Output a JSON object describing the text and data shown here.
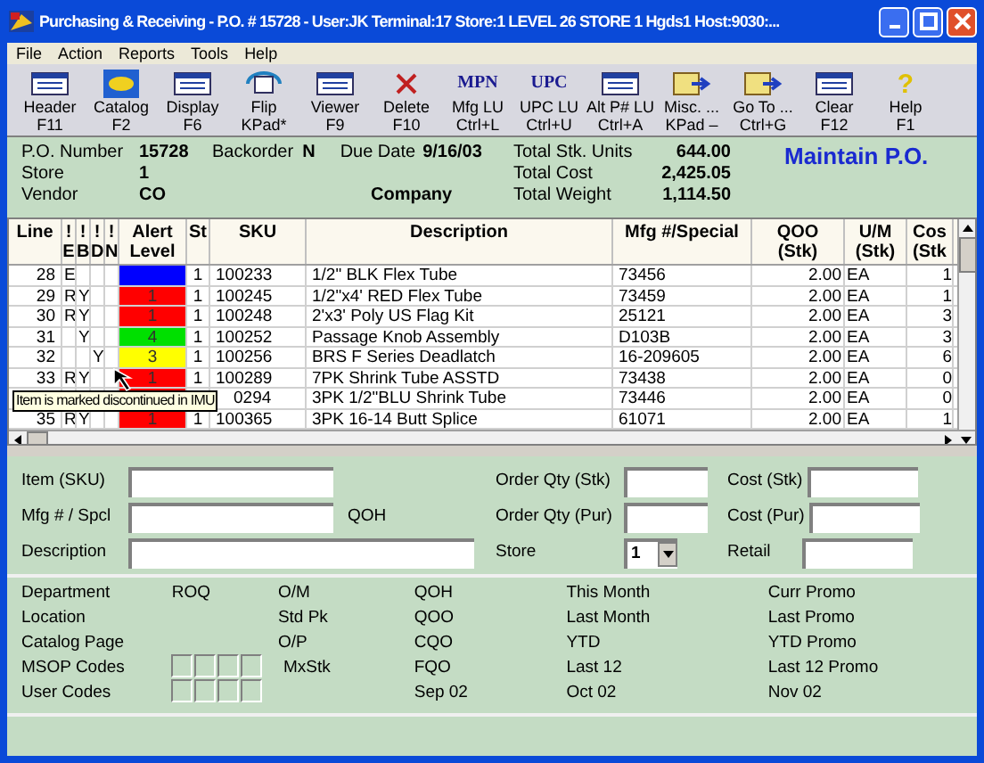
{
  "window": {
    "title": "Purchasing & Receiving - P.O. # 15728 - User:JK Terminal:17 Store:1 LEVEL 26 STORE 1 Hgds1 Host:9030:..."
  },
  "menu": [
    "File",
    "Action",
    "Reports",
    "Tools",
    "Help"
  ],
  "toolbar": [
    {
      "kind": "window",
      "label": "Header",
      "key": "F11"
    },
    {
      "kind": "catalog",
      "label": "Catalog",
      "key": "F2"
    },
    {
      "kind": "window",
      "label": "Display",
      "key": "F6"
    },
    {
      "kind": "flip",
      "label": "Flip",
      "key": "KPad*"
    },
    {
      "kind": "window",
      "label": "Viewer",
      "key": "F9"
    },
    {
      "kind": "x",
      "label": "Delete",
      "key": "F10"
    },
    {
      "kind": "text",
      "icon_text": "MPN",
      "label": "Mfg LU",
      "key": "Ctrl+L"
    },
    {
      "kind": "text",
      "icon_text": "UPC",
      "label": "UPC LU",
      "key": "Ctrl+U"
    },
    {
      "kind": "window",
      "label": "Alt P# LU",
      "key": "Ctrl+A"
    },
    {
      "kind": "folder",
      "label": "Misc. ...",
      "key": "KPad –"
    },
    {
      "kind": "folder",
      "label": "Go To ...",
      "key": "Ctrl+G"
    },
    {
      "kind": "window",
      "label": "Clear",
      "key": "F12"
    },
    {
      "kind": "question",
      "icon_text": "?",
      "label": "Help",
      "key": "F1"
    }
  ],
  "header": {
    "po_label": "P.O. Number",
    "po": "15728",
    "backorder_label": "Backorder",
    "backorder": "N",
    "due_label": "Due Date",
    "due": "9/16/03",
    "store_label": "Store",
    "store": "1",
    "vendor_label": "Vendor",
    "vendor": "CO",
    "vendor_name": "Company",
    "totals": [
      {
        "label": "Total Stk. Units",
        "value": "644.00"
      },
      {
        "label": "Total Cost",
        "value": "2,425.05"
      },
      {
        "label": "Total Weight",
        "value": "1,114.50"
      }
    ],
    "mode": "Maintain P.O."
  },
  "table": {
    "columns": [
      [
        "Line"
      ],
      [
        "!",
        "E"
      ],
      [
        "!",
        "B"
      ],
      [
        "!",
        "D"
      ],
      [
        "!",
        "N"
      ],
      [
        "Alert",
        "Level"
      ],
      [
        "St"
      ],
      [
        "SKU"
      ],
      [
        "Description"
      ],
      [
        "Mfg #/Special"
      ],
      [
        "QOO",
        "(Stk)"
      ],
      [
        "U/M",
        "(Stk)"
      ],
      [
        "Cos",
        "(Stk"
      ]
    ],
    "rows": [
      {
        "line": "28",
        "e": "E",
        "b": "",
        "d": "",
        "n": "",
        "alert": "",
        "color": "#0000ff",
        "st": "1",
        "sku": "100233",
        "desc": "1/2\" BLK Flex Tube",
        "mfg": "73456",
        "qoo": "2.00",
        "um": "EA",
        "cost": "1"
      },
      {
        "line": "29",
        "e": "R",
        "b": "Y",
        "d": "",
        "n": "",
        "alert": "1",
        "color": "#ff0000",
        "st": "1",
        "sku": "100245",
        "desc": "1/2\"x4' RED Flex Tube",
        "mfg": "73459",
        "qoo": "2.00",
        "um": "EA",
        "cost": "1"
      },
      {
        "line": "30",
        "e": "R",
        "b": "Y",
        "d": "",
        "n": "",
        "alert": "1",
        "color": "#ff0000",
        "st": "1",
        "sku": "100248",
        "desc": "2'x3' Poly US Flag Kit",
        "mfg": "25121",
        "qoo": "2.00",
        "um": "EA",
        "cost": "3"
      },
      {
        "line": "31",
        "e": "",
        "b": "Y",
        "d": "",
        "n": "",
        "alert": "4",
        "color": "#00e000",
        "st": "1",
        "sku": "100252",
        "desc": "Passage Knob Assembly",
        "mfg": "D103B",
        "qoo": "2.00",
        "um": "EA",
        "cost": "3"
      },
      {
        "line": "32",
        "e": "",
        "b": "",
        "d": "Y",
        "n": "",
        "alert": "3",
        "color": "#ffff00",
        "st": "1",
        "sku": "100256",
        "desc": "BRS F Series Deadlatch",
        "mfg": "16-209605",
        "qoo": "2.00",
        "um": "EA",
        "cost": "6"
      },
      {
        "line": "33",
        "e": "R",
        "b": "Y",
        "d": "",
        "n": "",
        "alert": "1",
        "color": "#ff0000",
        "st": "1",
        "sku": "100289",
        "desc": "7PK Shrink Tube ASSTD",
        "mfg": "73438",
        "qoo": "2.00",
        "um": "EA",
        "cost": "0"
      },
      {
        "line": "",
        "e": "",
        "b": "",
        "d": "",
        "n": "",
        "alert": "",
        "color": "#ff0000",
        "st": "",
        "sku": "0294",
        "desc": "3PK 1/2\"BLU Shrink Tube",
        "mfg": "73446",
        "qoo": "2.00",
        "um": "EA",
        "cost": "0"
      },
      {
        "line": "35",
        "e": "R",
        "b": "Y",
        "d": "",
        "n": "",
        "alert": "1",
        "color": "#ff0000",
        "st": "1",
        "sku": "100365",
        "desc": "3PK 16-14 Butt Splice",
        "mfg": "61071",
        "qoo": "2.00",
        "um": "EA",
        "cost": "1"
      }
    ],
    "tooltip": "Item is marked discontinued in IMU"
  },
  "form": {
    "item_label": "Item (SKU)",
    "mfg_label": "Mfg # / Spcl",
    "qoh_label": "QOH",
    "desc_label": "Description",
    "order_stk_label": "Order Qty (Stk)",
    "order_pur_label": "Order Qty (Pur)",
    "store_label": "Store",
    "store_value": "1",
    "cost_stk_label": "Cost (Stk)",
    "cost_pur_label": "Cost (Pur)",
    "retail_label": "Retail"
  },
  "info": {
    "col1": [
      "Department",
      "Location",
      "Catalog Page",
      "MSOP Codes",
      "User Codes"
    ],
    "roq": "ROQ",
    "col2": [
      "O/M",
      "Std Pk",
      "O/P",
      "MxStk"
    ],
    "col3": [
      "QOH",
      "QOO",
      "CQO",
      "FQO",
      "Sep 02"
    ],
    "col4": [
      "This Month",
      "Last Month",
      "YTD",
      "Last 12",
      "Oct 02"
    ],
    "col5": [
      "Curr Promo",
      "Last Promo",
      "YTD Promo",
      "Last 12 Promo",
      "Nov 02"
    ]
  }
}
